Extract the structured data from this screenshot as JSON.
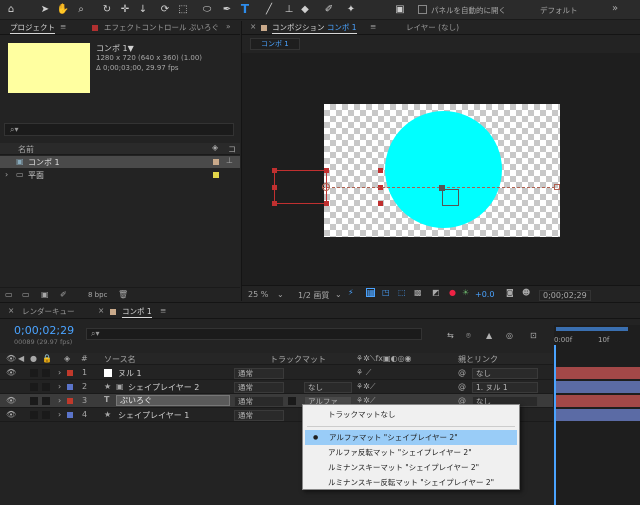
{
  "toolbar": {
    "tools": [
      "home-icon",
      "selection-icon",
      "hand-icon",
      "zoom-icon",
      "orbit-icon",
      "pan-behind-icon",
      "anchor-icon",
      "mask-rect-icon",
      "ellipse-icon",
      "pen-icon",
      "type-icon",
      "brush-icon",
      "clone-icon",
      "eraser-icon",
      "roto-icon",
      "puppet-icon"
    ],
    "auto_open_label": "パネルを自動的に開く",
    "workspace_label": "デフォルト"
  },
  "project_panel": {
    "tab_project": "プロジェクト",
    "tab_effects": "エフェクトコントロール ぷいろぐ",
    "comp_name": "コンポ 1▼",
    "comp_info_1": "1280 x 720 (640 x 360) (1.00)",
    "comp_info_2": "Δ 0;00;03;00, 29.97 fps",
    "search_placeholder": "",
    "col_name": "名前",
    "col_extra": "コ",
    "items": [
      {
        "name": "コンポ 1",
        "color": "#c9a98a"
      },
      {
        "name": "平面",
        "color": "#e2d54a"
      }
    ],
    "bpc": "8 bpc"
  },
  "comp_panel": {
    "tab_comp": "コンポジション",
    "comp_link": "コンポ 1",
    "tab_layer": "レイヤー (なし)",
    "sub_tab": "コンポ 1",
    "zoom": "25 %",
    "resolution": "1/2 画質",
    "exposure": "+0.0",
    "timecode": "0;00;02;29"
  },
  "timeline": {
    "tab_render": "レンダーキュー",
    "tab_comp": "コンポ 1",
    "timecode": "0;00;02;29",
    "frames": "00089 (29.97 fps)",
    "col_num": "#",
    "col_source": "ソース名",
    "col_track": "トラックマット",
    "col_parent": "親とリンク",
    "ruler_0": "0:00f",
    "ruler_10": "10f",
    "layers": [
      {
        "num": "1",
        "name": "ヌル 1",
        "mode": "通常",
        "track": "",
        "parent": "なし",
        "color": "#c0392b"
      },
      {
        "num": "2",
        "name": "シェイプレイヤー 2",
        "mode": "通常",
        "track": "なし",
        "parent": "1. ヌル 1",
        "color": "#5b74c9"
      },
      {
        "num": "3",
        "name": "ぷいろぐ",
        "mode": "通常",
        "track": "アルファ",
        "parent": "なし",
        "color": "#c0392b"
      },
      {
        "num": "4",
        "name": "シェイプレイヤー 1",
        "mode": "通常",
        "track": "",
        "parent": "",
        "color": "#5b74c9"
      }
    ]
  },
  "menu": {
    "items": [
      "トラックマットなし",
      "アルファマット \"シェイプレイヤー 2\"",
      "アルファ反転マット \"シェイプレイヤー 2\"",
      "ルミナンスキーマット \"シェイプレイヤー 2\"",
      "ルミナンスキー反転マット \"シェイプレイヤー 2\""
    ]
  }
}
